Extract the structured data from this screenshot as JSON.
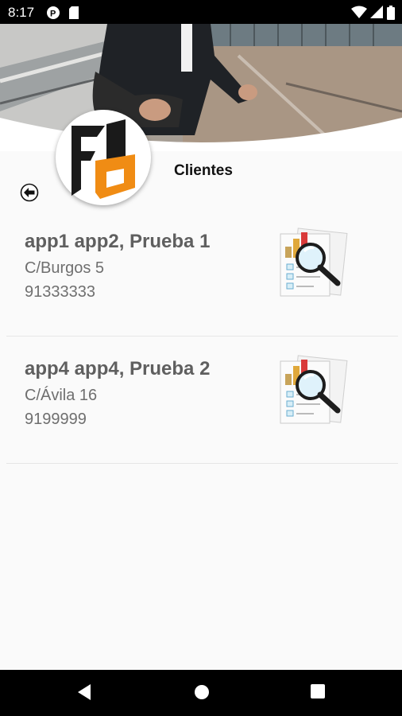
{
  "status_bar": {
    "time": "8:17"
  },
  "header": {
    "title": "Clientes"
  },
  "clients": [
    {
      "name": "app1 app2, Prueba 1",
      "address": "C/Burgos 5",
      "phone": "91333333"
    },
    {
      "name": "app4 app4, Prueba 2",
      "address": "C/Ávila 16",
      "phone": "9199999"
    }
  ],
  "icons": {
    "back": "back-arrow-icon",
    "client_detail": "document-search-icon"
  },
  "colors": {
    "logo_orange": "#f08c14",
    "logo_dark": "#1a1a1a",
    "status_bar": "#000000",
    "background": "#fafafa"
  }
}
